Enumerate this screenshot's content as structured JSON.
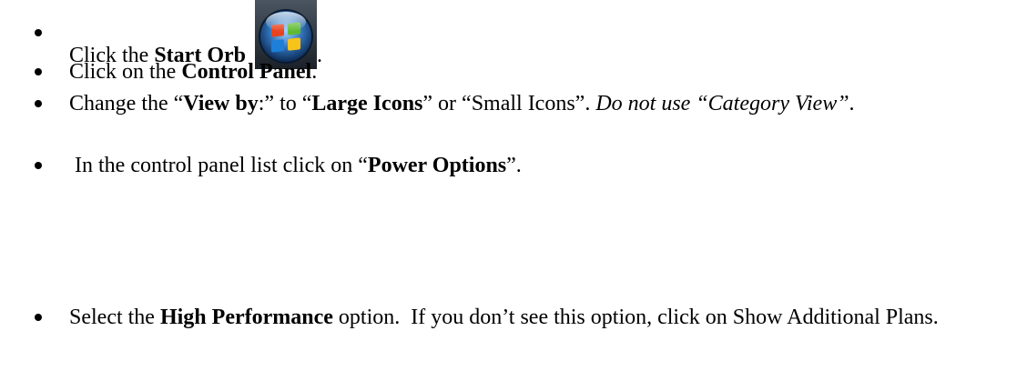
{
  "steps": [
    {
      "parts": [
        {
          "t": "Click the ",
          "s": "plain"
        },
        {
          "t": "Start Orb",
          "s": "bold"
        }
      ],
      "after_icon": "."
    },
    {
      "parts": [
        {
          "t": "Click on the ",
          "s": "plain"
        },
        {
          "t": "Control Panel",
          "s": "bold"
        },
        {
          "t": ".",
          "s": "plain"
        }
      ]
    },
    {
      "parts": [
        {
          "t": "Change the “",
          "s": "plain"
        },
        {
          "t": "View by",
          "s": "bold"
        },
        {
          "t": ":” to “",
          "s": "plain"
        },
        {
          "t": "Large Icons",
          "s": "bold"
        },
        {
          "t": "” or “Small Icons”. ",
          "s": "plain"
        },
        {
          "t": "Do not use “Category View”",
          "s": "italic"
        },
        {
          "t": ".",
          "s": "plain"
        }
      ]
    },
    {
      "parts": [
        {
          "t": " In the control panel list click on “",
          "s": "plain"
        },
        {
          "t": "Power Options",
          "s": "bold"
        },
        {
          "t": "”.",
          "s": "plain"
        }
      ]
    },
    {
      "parts": [
        {
          "t": "Select the ",
          "s": "plain"
        },
        {
          "t": "High Performance",
          "s": "bold"
        },
        {
          "t": " option.  If you don’t see this option, click on Show Additional Plans.",
          "s": "plain"
        }
      ]
    }
  ],
  "icons": {
    "start_orb": "windows-start-orb-icon",
    "bullet": "bullet-dot-icon"
  },
  "colors": {
    "text": "#000000",
    "orb_flag_red": "#e8431f",
    "orb_flag_green": "#5fba33",
    "orb_flag_blue": "#1e7fd8",
    "orb_flag_yellow": "#f7c21a",
    "orb_blue": "#1c4f86"
  }
}
